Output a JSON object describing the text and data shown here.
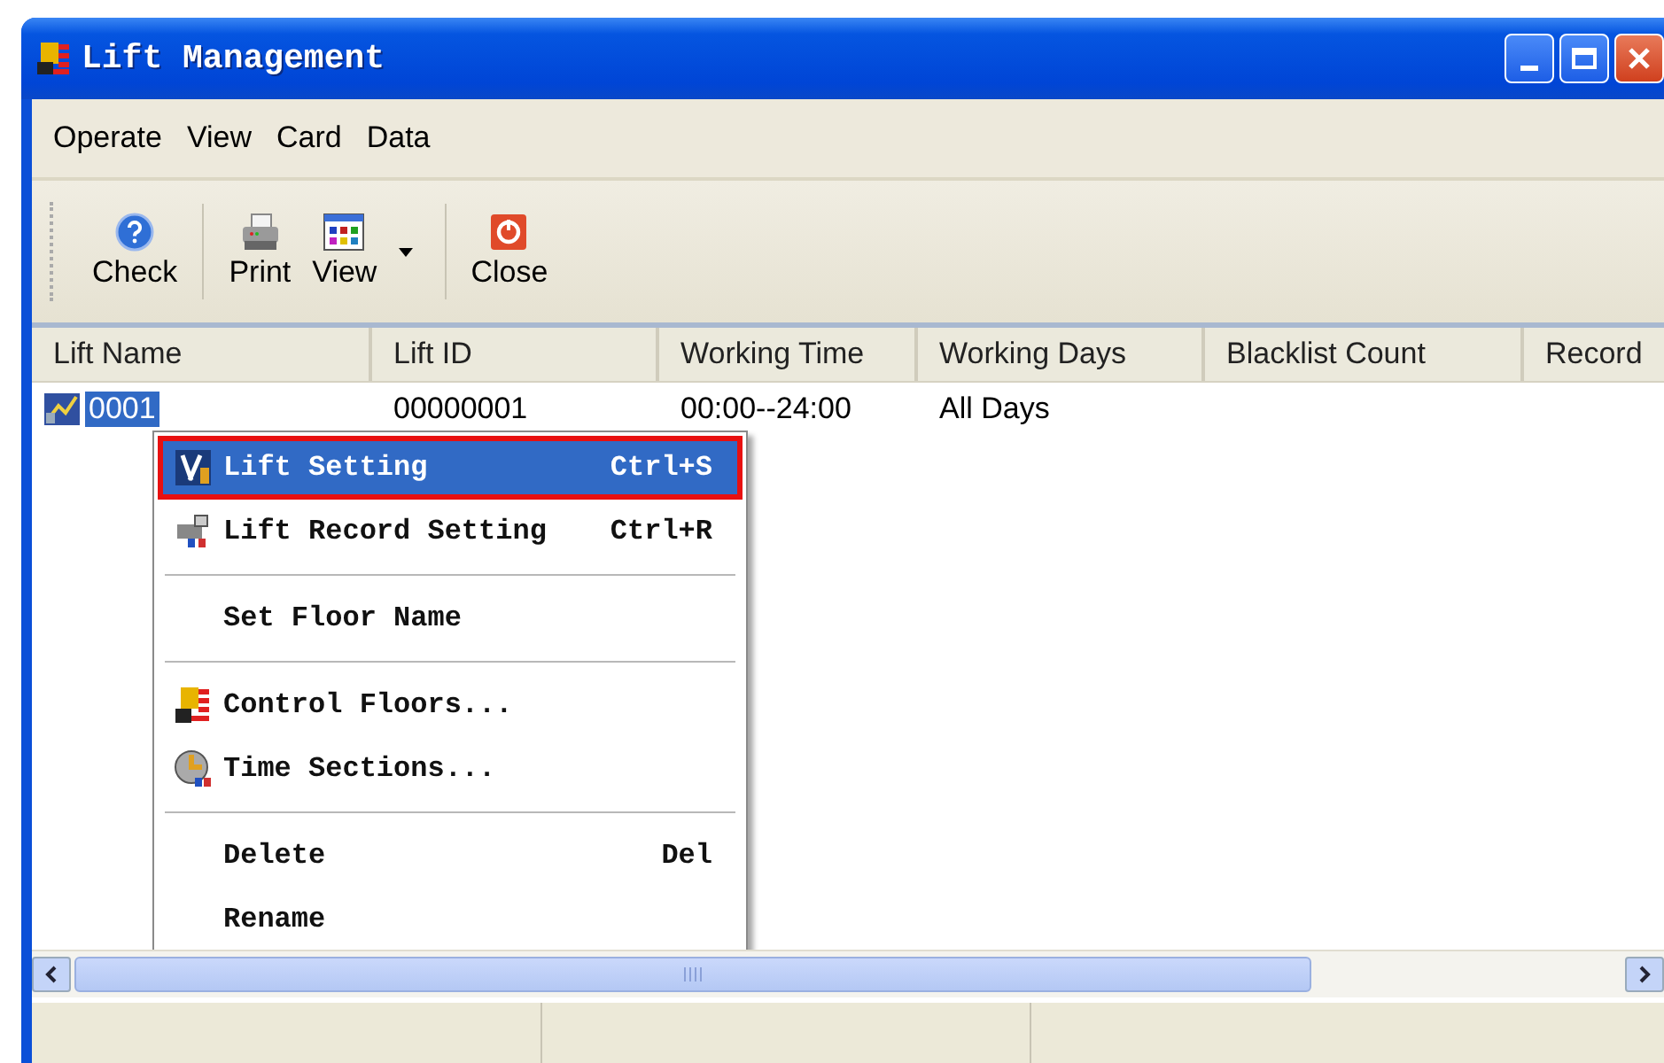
{
  "window": {
    "title": "Lift Management"
  },
  "menu_bar": [
    "Operate",
    "View",
    "Card",
    "Data"
  ],
  "toolbar": [
    {
      "label": "Check",
      "kind": "help"
    },
    {
      "label": "Print",
      "kind": "print"
    },
    {
      "label": "View",
      "kind": "view"
    },
    {
      "label": "Close",
      "kind": "close"
    }
  ],
  "table": {
    "columns": [
      "Lift Name",
      "Lift ID",
      "Working Time",
      "Working Days",
      "Blacklist Count",
      "Record"
    ],
    "rows": [
      {
        "selected": true,
        "cells": [
          "0001",
          "00000001",
          "00:00--24:00",
          "All Days"
        ]
      }
    ]
  },
  "context_menu": [
    {
      "kind": "item",
      "label": "Lift Setting",
      "shortcut": "Ctrl+S",
      "selected": true
    },
    {
      "kind": "item",
      "label": "Lift Record Setting",
      "shortcut": "Ctrl+R",
      "selected": false
    },
    {
      "kind": "separator"
    },
    {
      "kind": "item",
      "label": "Set Floor Name",
      "selected": false
    },
    {
      "kind": "separator"
    },
    {
      "kind": "item",
      "label": "Control Floors...",
      "selected": false
    },
    {
      "kind": "item",
      "label": "Time Sections...",
      "selected": false
    },
    {
      "kind": "separator"
    },
    {
      "kind": "item",
      "label": "Delete",
      "shortcut": "Del",
      "selected": false
    },
    {
      "kind": "item",
      "label": "Rename",
      "selected": false
    }
  ]
}
